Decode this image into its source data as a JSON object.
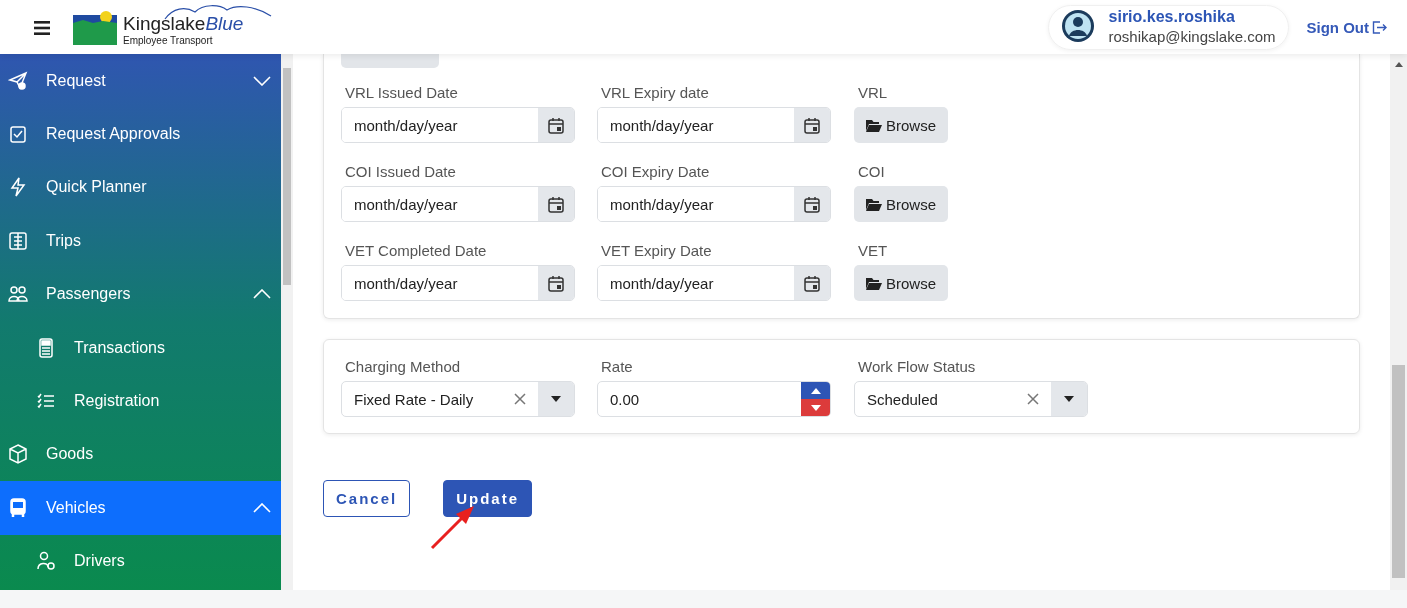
{
  "header": {
    "logo": {
      "text": "Kingslake",
      "accent": "Blue",
      "tagline": "Employee Transport"
    },
    "user": {
      "name": "sirio.kes.roshika",
      "email": "roshikap@kingslake.com"
    },
    "sign_out": "Sign Out"
  },
  "sidebar": {
    "items": [
      {
        "label": "Request",
        "selected": false,
        "expanded": false
      },
      {
        "label": "Request Approvals",
        "selected": false
      },
      {
        "label": "Quick Planner",
        "selected": false
      },
      {
        "label": "Trips",
        "selected": false
      },
      {
        "label": "Passengers",
        "selected": false,
        "expanded": true,
        "children": [
          {
            "label": "Transactions",
            "selected": false
          },
          {
            "label": "Registration",
            "selected": false
          }
        ]
      },
      {
        "label": "Goods",
        "selected": false
      },
      {
        "label": "Vehicles",
        "selected": true,
        "expanded": true,
        "children": [
          {
            "label": "Drivers",
            "selected": false
          }
        ]
      }
    ]
  },
  "documents": [
    {
      "fields": [
        {
          "label": "VRL Issued Date",
          "placeholder": "month/day/year"
        },
        {
          "label": "VRL Expiry date",
          "placeholder": "month/day/year"
        }
      ],
      "upload": {
        "label": "VRL",
        "button": "Browse"
      }
    },
    {
      "fields": [
        {
          "label": "COI Issued Date",
          "placeholder": "month/day/year"
        },
        {
          "label": "COI Expiry Date",
          "placeholder": "month/day/year"
        }
      ],
      "upload": {
        "label": "COI",
        "button": "Browse"
      }
    },
    {
      "fields": [
        {
          "label": "VET Completed Date",
          "placeholder": "month/day/year"
        },
        {
          "label": "VET Expiry Date",
          "placeholder": "month/day/year"
        }
      ],
      "upload": {
        "label": "VET",
        "button": "Browse"
      }
    }
  ],
  "charges": {
    "charging_method": {
      "label": "Charging Method",
      "value": "Fixed Rate - Daily"
    },
    "rate": {
      "label": "Rate",
      "value": "0.00"
    },
    "work_flow_status": {
      "label": "Work Flow Status",
      "value": "Scheduled"
    }
  },
  "actions": {
    "cancel": "Cancel",
    "update": "Update"
  }
}
